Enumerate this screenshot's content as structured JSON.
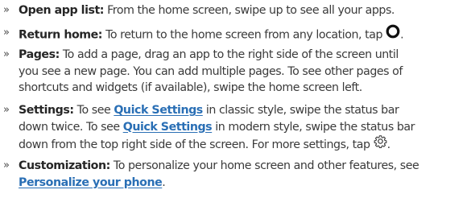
{
  "items": [
    {
      "term": "Open app list:",
      "lines": [
        "From the home screen, swipe up to see all your apps."
      ]
    },
    {
      "term": "Return home:",
      "lines": [
        "To return to the home screen from any location, tap"
      ],
      "after_icon": ".",
      "icon": "home-circle-icon"
    },
    {
      "term": "Pages:",
      "lines": [
        "To add a page, drag an app to the right side of the screen until",
        "you see a new page. You can add multiple pages. To see other pages of",
        "shortcuts and widgets (if available), swipe the home screen left."
      ]
    },
    {
      "term": "Settings:",
      "line1_pre": "To see",
      "link": "Quick Settings",
      "line1_post": "in classic style, swipe the status bar",
      "line2_pre": "down twice. To see",
      "line2_post": "in modern style, swipe the status bar",
      "line3": "down from the top right side of the screen. For more settings, tap",
      "line3_end": ".",
      "icon": "gear-icon"
    },
    {
      "term": "Customization:",
      "line1": "To personalize your home screen and other features, see",
      "link": "Personalize your phone",
      "line2_end": "."
    }
  ],
  "bullet": "»",
  "colors": {
    "text": "#3a3a3a",
    "term": "#262626",
    "link": "#2a6fb5"
  }
}
